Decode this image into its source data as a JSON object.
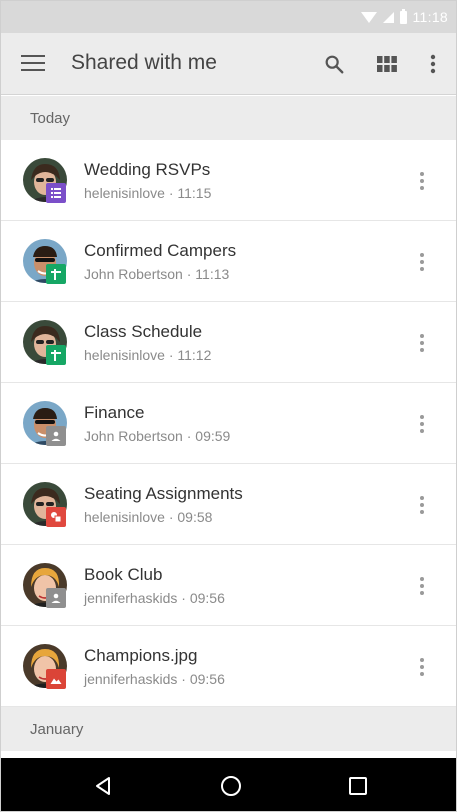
{
  "status_bar": {
    "time": "11:18"
  },
  "app_bar": {
    "title": "Shared with me",
    "icons": [
      "menu-icon",
      "search-icon",
      "grid-view-icon",
      "more-vert-icon"
    ]
  },
  "sections": [
    {
      "label": "Today",
      "items": [
        {
          "title": "Wedding RSVPs",
          "owner": "helenisinlove",
          "time": "11:15",
          "meta": "helenisinlove · 11:15",
          "file_type": "forms",
          "badge_color": "#7b4fc9",
          "avatar": "helen"
        },
        {
          "title": "Confirmed Campers",
          "owner": "John Robertson",
          "time": "11:13",
          "meta": "John Robertson · 11:13",
          "file_type": "sheets",
          "badge_color": "#16a765",
          "avatar": "john"
        },
        {
          "title": "Class Schedule",
          "owner": "helenisinlove",
          "time": "11:12",
          "meta": "helenisinlove · 11:12",
          "file_type": "sheets",
          "badge_color": "#16a765",
          "avatar": "helen"
        },
        {
          "title": "Finance",
          "owner": "John Robertson",
          "time": "09:59",
          "meta": "John Robertson · 09:59",
          "file_type": "shared-folder",
          "badge_color": "#8f8f8f",
          "avatar": "john"
        },
        {
          "title": "Seating Assignments",
          "owner": "helenisinlove",
          "time": "09:58",
          "meta": "helenisinlove · 09:58",
          "file_type": "drawing",
          "badge_color": "#e0483e",
          "avatar": "helen"
        },
        {
          "title": "Book Club",
          "owner": "jenniferhaskids",
          "time": "09:56",
          "meta": "jenniferhaskids · 09:56",
          "file_type": "shared-folder",
          "badge_color": "#8f8f8f",
          "avatar": "jennifer"
        },
        {
          "title": "Champions.jpg",
          "owner": "jenniferhaskids",
          "time": "09:56",
          "meta": "jenniferhaskids · 09:56",
          "file_type": "image",
          "badge_color": "#db4437",
          "avatar": "jennifer"
        }
      ]
    },
    {
      "label": "January",
      "items": []
    }
  ],
  "nav_bar": {
    "icons": [
      "back-icon",
      "home-icon",
      "recents-icon"
    ]
  }
}
